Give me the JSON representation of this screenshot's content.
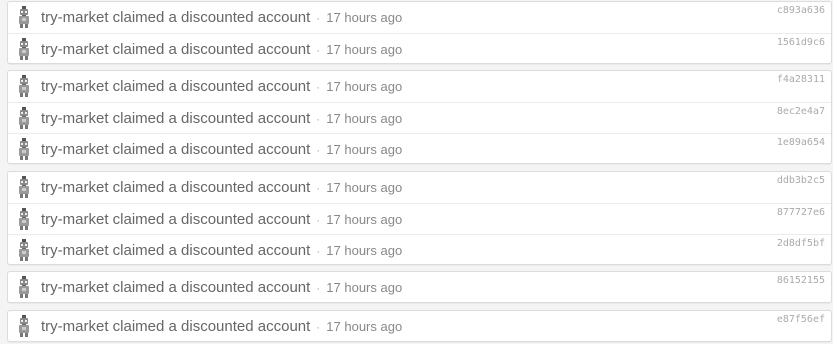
{
  "groups": [
    {
      "events": [
        {
          "user": "try-market",
          "action": "claimed a discounted account",
          "time": "17 hours ago",
          "hash": "c893a636"
        },
        {
          "user": "try-market",
          "action": "claimed a discounted account",
          "time": "17 hours ago",
          "hash": "1561d9c6"
        }
      ]
    },
    {
      "events": [
        {
          "user": "try-market",
          "action": "claimed a discounted account",
          "time": "17 hours ago",
          "hash": "f4a28311"
        },
        {
          "user": "try-market",
          "action": "claimed a discounted account",
          "time": "17 hours ago",
          "hash": "8ec2e4a7"
        },
        {
          "user": "try-market",
          "action": "claimed a discounted account",
          "time": "17 hours ago",
          "hash": "1e89a654"
        }
      ]
    },
    {
      "events": [
        {
          "user": "try-market",
          "action": "claimed a discounted account",
          "time": "17 hours ago",
          "hash": "ddb3b2c5"
        },
        {
          "user": "try-market",
          "action": "claimed a discounted account",
          "time": "17 hours ago",
          "hash": "877727e6"
        },
        {
          "user": "try-market",
          "action": "claimed a discounted account",
          "time": "17 hours ago",
          "hash": "2d8df5bf"
        }
      ]
    },
    {
      "events": [
        {
          "user": "try-market",
          "action": "claimed a discounted account",
          "time": "17 hours ago",
          "hash": "86152155"
        }
      ]
    },
    {
      "events": [
        {
          "user": "try-market",
          "action": "claimed a discounted account",
          "time": "17 hours ago",
          "hash": "e87f56ef"
        }
      ]
    }
  ],
  "separator": "·",
  "avatar_icon": "robot-avatar-icon"
}
